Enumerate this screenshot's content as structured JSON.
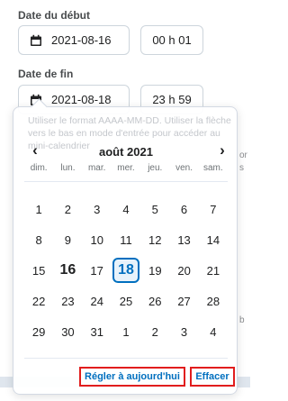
{
  "start": {
    "label": "Date du début",
    "date": "2021-08-16",
    "time": "00 h 01"
  },
  "end": {
    "label": "Date de fin",
    "date": "2021-08-18",
    "time": "23 h 59"
  },
  "icons": {
    "date_field": "calendar-icon",
    "prev": "chevron-left-icon",
    "next": "chevron-right-icon"
  },
  "calendar": {
    "tooltip": "Utiliser le format AAAA-MM-DD. Utiliser la flèche vers le bas en mode d'entrée pour accéder au mini-calendrier",
    "month": "août 2021",
    "prev_glyph": "‹",
    "next_glyph": "›",
    "weekdays": [
      "dim.",
      "lun.",
      "mar.",
      "mer.",
      "jeu.",
      "ven.",
      "sam."
    ],
    "weeks": [
      [
        "1",
        "2",
        "3",
        "4",
        "5",
        "6",
        "7"
      ],
      [
        "8",
        "9",
        "10",
        "11",
        "12",
        "13",
        "14"
      ],
      [
        "15",
        "16",
        "17",
        "18",
        "19",
        "20",
        "21"
      ],
      [
        "22",
        "23",
        "24",
        "25",
        "26",
        "27",
        "28"
      ],
      [
        "29",
        "30",
        "31",
        "1",
        "2",
        "3",
        "4"
      ]
    ],
    "today": "16",
    "selected": "18",
    "set_today_label": "Régler à aujourd'hui",
    "clear_label": "Effacer"
  },
  "background": {
    "fragments": [
      "or",
      "s",
      "b"
    ]
  },
  "colors": {
    "accent": "#006fbf",
    "highlight_outline": "#e11d1d"
  }
}
